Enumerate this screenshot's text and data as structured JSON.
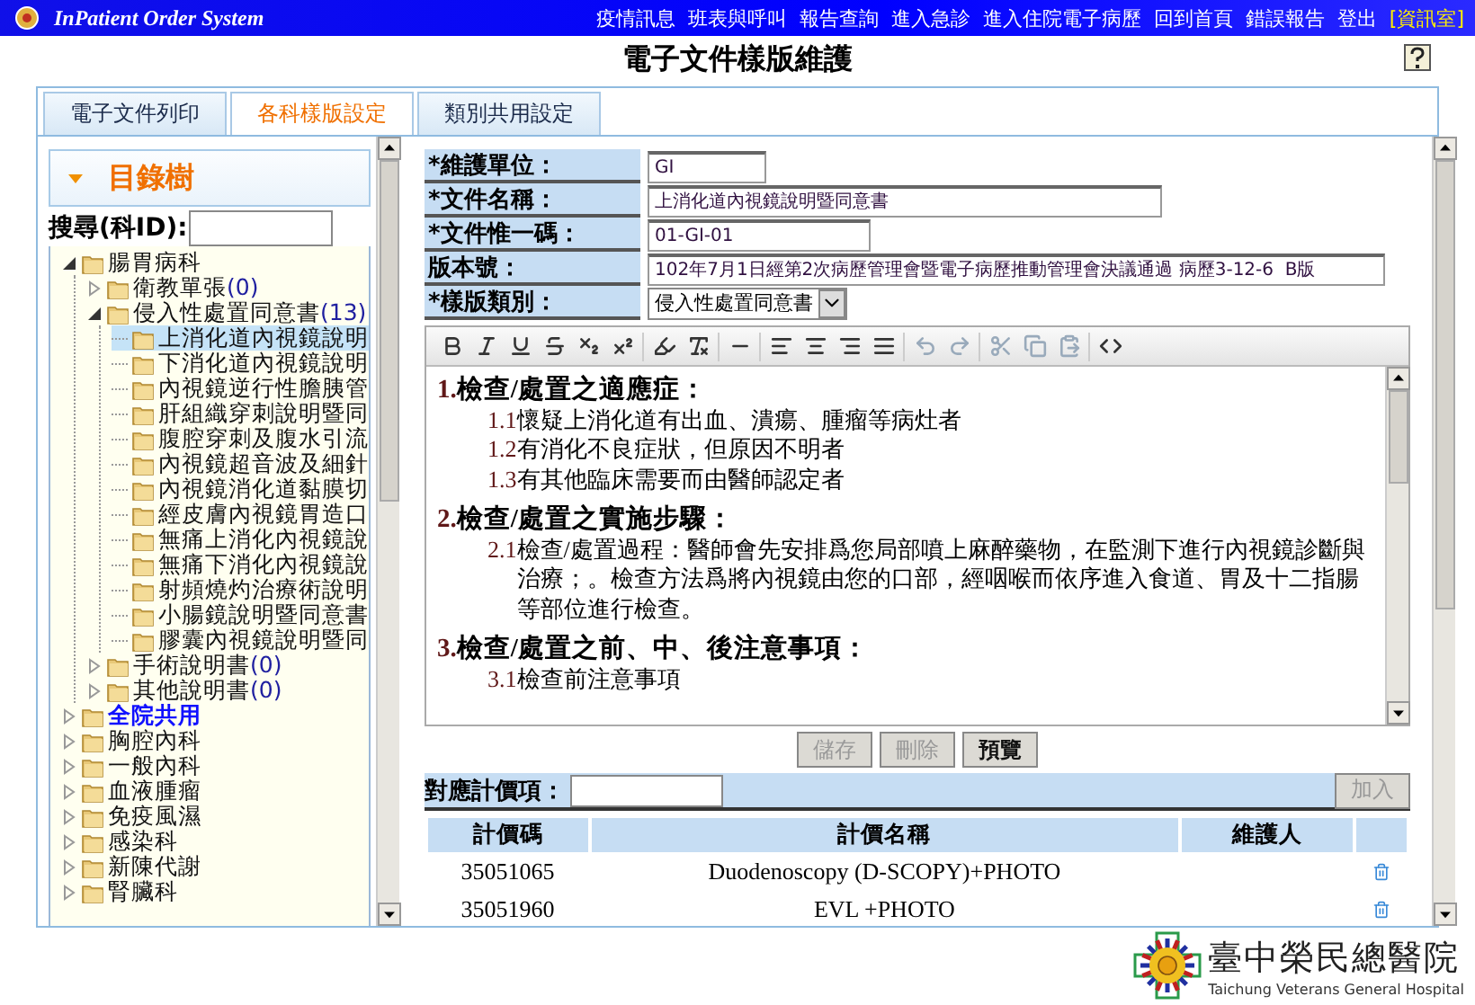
{
  "header": {
    "system_name": "InPatient Order System",
    "nav_links": [
      "疫情訊息",
      "班表與呼叫",
      "報告查詢",
      "進入急診",
      "進入住院電子病歷",
      "回到首頁",
      "錯誤報告",
      "登出"
    ],
    "unit_link": "[資訊室]"
  },
  "page_title": "電子文件樣版維護",
  "tabs": [
    {
      "label": "電子文件列印",
      "selected": false
    },
    {
      "label": "各科樣版設定",
      "selected": true
    },
    {
      "label": "類別共用設定",
      "selected": false
    }
  ],
  "directory_tree": {
    "title": "目錄樹",
    "search_label": "搜尋(科ID):",
    "items": [
      {
        "label": "腸胃病科",
        "expanded": true,
        "selected": false,
        "highlighted": false,
        "children": [
          {
            "label": "衛教單張",
            "count": "(0)",
            "expanded": false,
            "selected": false
          },
          {
            "label": "侵入性處置同意書",
            "count": "(13)",
            "expanded": true,
            "selected": false,
            "children": [
              {
                "label": "上消化道內視鏡說明",
                "selected": true
              },
              {
                "label": "下消化道內視鏡說明",
                "selected": false
              },
              {
                "label": "內視鏡逆行性膽胰管",
                "selected": false
              },
              {
                "label": "肝組織穿刺說明暨同",
                "selected": false
              },
              {
                "label": "腹腔穿刺及腹水引流",
                "selected": false
              },
              {
                "label": "內視鏡超音波及細針",
                "selected": false
              },
              {
                "label": "內視鏡消化道黏膜切",
                "selected": false
              },
              {
                "label": "經皮膚內視鏡胃造口",
                "selected": false
              },
              {
                "label": "無痛上消化內視鏡說",
                "selected": false
              },
              {
                "label": "無痛下消化內視鏡說",
                "selected": false
              },
              {
                "label": "射頻燒灼治療術說明",
                "selected": false
              },
              {
                "label": "小腸鏡說明暨同意書",
                "selected": false
              },
              {
                "label": "膠囊內視鏡說明暨同",
                "selected": false
              }
            ]
          },
          {
            "label": "手術說明書",
            "count": "(0)",
            "expanded": false,
            "selected": false
          },
          {
            "label": "其他說明書",
            "count": "(0)",
            "expanded": false,
            "selected": false
          }
        ]
      },
      {
        "label": "全院共用",
        "expanded": false,
        "selected": false,
        "highlighted": true
      },
      {
        "label": "胸腔內科",
        "expanded": false,
        "selected": false,
        "highlighted": false
      },
      {
        "label": "一般內科",
        "expanded": false,
        "selected": false,
        "highlighted": false
      },
      {
        "label": "血液腫瘤",
        "expanded": false,
        "selected": false,
        "highlighted": false
      },
      {
        "label": "免疫風濕",
        "expanded": false,
        "selected": false,
        "highlighted": false
      },
      {
        "label": "感染科",
        "expanded": false,
        "selected": false,
        "highlighted": false
      },
      {
        "label": "新陳代謝",
        "expanded": false,
        "selected": false,
        "highlighted": false
      },
      {
        "label": "腎臟科",
        "expanded": false,
        "selected": false,
        "highlighted": false
      }
    ]
  },
  "form": {
    "fields": [
      {
        "label": "*維護單位：",
        "kind": "text",
        "value": "GI"
      },
      {
        "label": "*文件名稱：",
        "kind": "text",
        "value": "上消化道內視鏡說明暨同意書"
      },
      {
        "label": "*文件惟一碼：",
        "kind": "text",
        "value": "01-GI-01"
      },
      {
        "label": "版本號：",
        "kind": "text",
        "value": "102年7月1日經第2次病歷管理會暨電子病歷推動管理會決議通過 病歷3-12-6  B版"
      },
      {
        "label": "*樣版類別：",
        "kind": "select",
        "value": "侵入性處置同意書"
      }
    ]
  },
  "editor": {
    "content": [
      {
        "kind": "heading",
        "number": "1.",
        "text": "檢查/處置之適應症："
      },
      {
        "kind": "item",
        "number": "1.1",
        "text": "懷疑上消化道有出血、潰瘍、腫瘤等病灶者"
      },
      {
        "kind": "item",
        "number": "1.2",
        "text": "有消化不良症狀，但原因不明者"
      },
      {
        "kind": "item",
        "number": "1.3",
        "text": "有其他臨床需要而由醫師認定者"
      },
      {
        "kind": "heading",
        "number": "2.",
        "text": "檢查/處置之實施步驟："
      },
      {
        "kind": "item",
        "number": "2.1",
        "text": "檢查/處置過程：醫師會先安排爲您局部噴上麻醉藥物，在監測下進行內視鏡診斷與治療；。檢查方法爲將內視鏡由您的口部，經咽喉而依序進入食道、胃及十二指腸等部位進行檢查。"
      },
      {
        "kind": "heading",
        "number": "3.",
        "text": "檢查/處置之前、中、後注意事項："
      },
      {
        "kind": "item",
        "number": "3.1",
        "text": "檢查前注意事項"
      }
    ]
  },
  "actions": [
    {
      "label": "儲存",
      "disabled": true
    },
    {
      "label": "刪除",
      "disabled": true
    },
    {
      "label": "預覽",
      "disabled": false
    }
  ],
  "billing": {
    "label": "對應計價項：",
    "add_button": {
      "label": "加入",
      "disabled": true
    },
    "columns": [
      "計價碼",
      "計價名稱",
      "維護人"
    ],
    "rows": [
      {
        "code": "35051065",
        "name": "Duodenoscopy (D-SCOPY)+PHOTO"
      },
      {
        "code": "35051960",
        "name": "EVL +PHOTO"
      }
    ]
  },
  "hospital_logo": {
    "name": "臺中榮民總醫院",
    "name_en": "Taichung Veterans General Hospital"
  }
}
